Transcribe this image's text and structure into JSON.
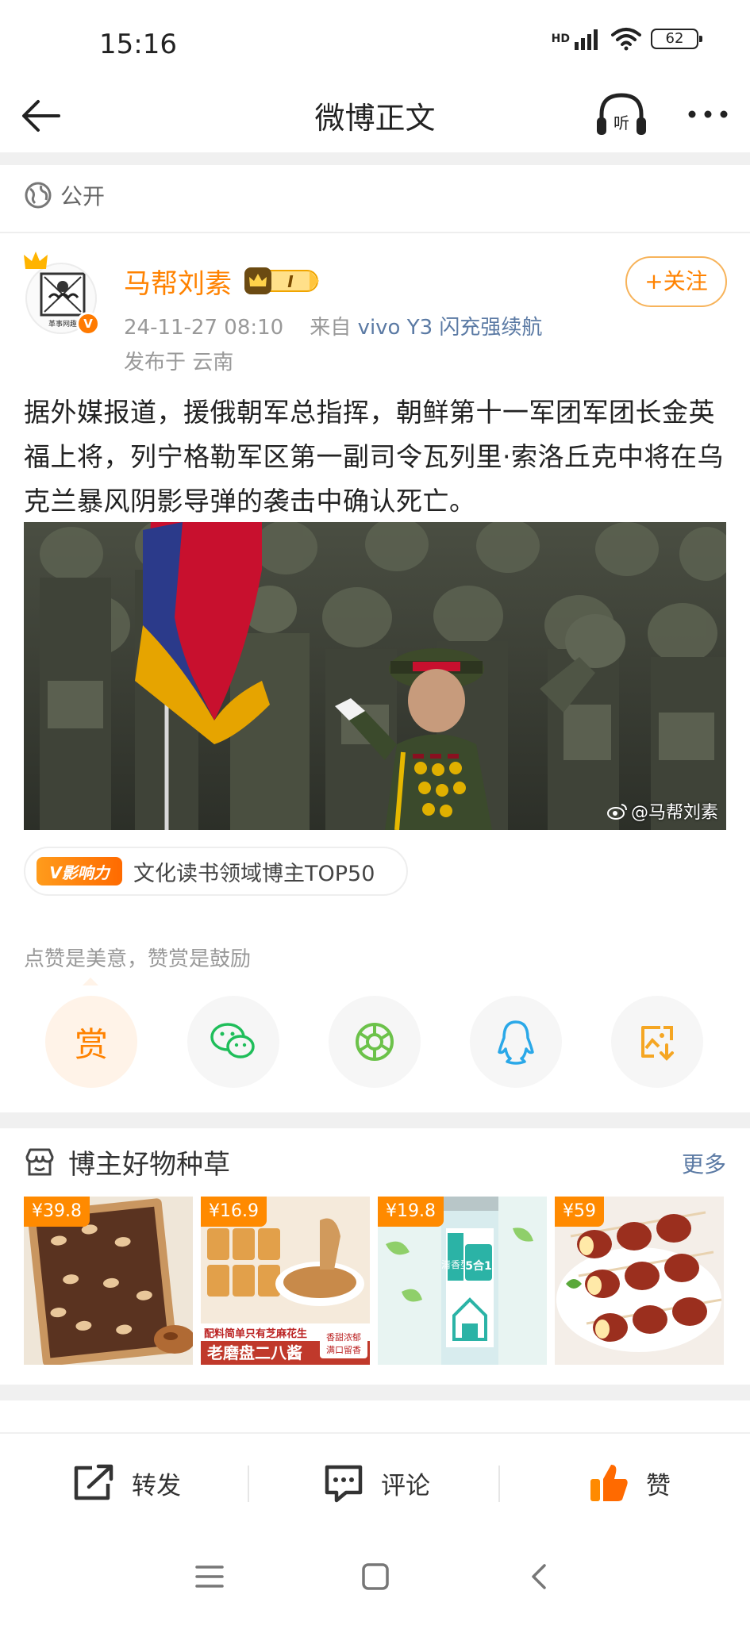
{
  "status_bar": {
    "time": "15:16",
    "network": "HD",
    "battery": "62",
    "icons": [
      "signal-icon",
      "wifi-icon",
      "battery-icon"
    ]
  },
  "nav": {
    "title": "微博正文",
    "icons": [
      "back-arrow-icon",
      "listen-headphones-icon",
      "more-dots-icon"
    ]
  },
  "visibility": {
    "label": "公开",
    "icon": "globe-icon"
  },
  "author": {
    "name": "马帮刘素",
    "level_label": "I",
    "avatar_caption": "革事网趣",
    "verified_mark": "V",
    "follow_label": "+关注",
    "timestamp": "24-11-27 08:10",
    "source_prefix": "来自",
    "source": "vivo Y3 闪充强续航",
    "location": "发布于 云南"
  },
  "post": {
    "text": "据外媒报道，援俄朝军总指挥，朝鲜第十一军团军团长金英福上将，列宁格勒军区第一副司令瓦列里·索洛丘克中将在乌克兰暴风阴影导弹的袭击中确认死亡。",
    "image_watermark": "@马帮刘素"
  },
  "influence": {
    "logo_text": "V影响力",
    "label": "文化读书领域博主TOP50"
  },
  "tip": {
    "text": "点赞是美意，赞赏是鼓励"
  },
  "share": {
    "reward_label": "赏",
    "icons": [
      "reward-icon",
      "wechat-icon",
      "moments-icon",
      "qq-icon",
      "save-image-icon"
    ]
  },
  "goods": {
    "title": "博主好物种草",
    "more_label": "更多",
    "items": [
      {
        "price": "¥39.8",
        "caption": ""
      },
      {
        "price": "¥16.9",
        "caption_top": "配料简单只有芝麻花生",
        "caption_bottom": "老磨盘二八酱",
        "side": "香甜浓郁 满口留香"
      },
      {
        "price": "¥19.8",
        "caption_top": "清香型",
        "caption_bottom": "5合1"
      },
      {
        "price": "¥59",
        "caption": ""
      }
    ]
  },
  "actions": {
    "repost": "转发",
    "comment": "评论",
    "like": "赞"
  },
  "colors": {
    "accent": "#ff8200",
    "link": "#5b7aa4",
    "muted": "#999999",
    "divider": "#f0f0f0"
  }
}
